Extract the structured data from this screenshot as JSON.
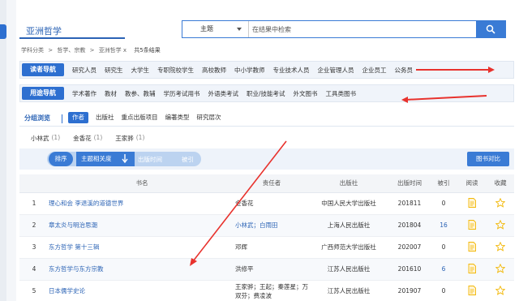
{
  "header": {
    "title": "亚洲哲学",
    "search": {
      "field": "主题",
      "placeholder": "在结果中检索"
    }
  },
  "breadcrumb": {
    "items": [
      "学科分类",
      ">",
      "哲学、宗教",
      ">",
      "亚洲哲学 x"
    ],
    "count": "共5条结果"
  },
  "reader_nav": {
    "label": "读者导航",
    "items": [
      "研究人员",
      "研究生",
      "大学生",
      "专职院校学生",
      "高校教师",
      "中小学教师",
      "专业技术人员",
      "企业管理人员",
      "企业员工",
      "公务员"
    ]
  },
  "purpose_nav": {
    "label": "用途导航",
    "items": [
      "学术著作",
      "教材",
      "教参、教辅",
      "学历考试用书",
      "外语类考试",
      "职业/技能考试",
      "外文图书",
      "工具类图书"
    ]
  },
  "group_browse": {
    "label": "分组浏览",
    "tabs": [
      "作者",
      "出版社",
      "重点出版项目",
      "编著类型",
      "研究层次"
    ]
  },
  "authors": [
    {
      "name": "小林武",
      "count": "(1)"
    },
    {
      "name": "金香花",
      "count": "(1)"
    },
    {
      "name": "王家骅",
      "count": "(1)"
    }
  ],
  "sort": {
    "label": "排序",
    "relevance": "主题相关度",
    "time": "出版时间",
    "cite": "被引",
    "compare": "图书对比"
  },
  "table": {
    "headers": [
      "书名",
      "责任者",
      "出版社",
      "出版时间",
      "被引",
      "阅读",
      "收藏"
    ],
    "rows": [
      {
        "no": "1",
        "title": "理心和会 李退溪的道德世界",
        "author": "金香花",
        "publisher": "中国人民大学出版社",
        "date": "201811",
        "cite": "0"
      },
      {
        "no": "2",
        "title": "章太炎与明治思潮",
        "author": "小林武；白雨田",
        "publisher": "上海人民出版社",
        "date": "201804",
        "cite": "16"
      },
      {
        "no": "3",
        "title": "东方哲学 第十三辑",
        "author": "邓辉",
        "publisher": "广西师范大学出版社",
        "date": "202007",
        "cite": "0"
      },
      {
        "no": "4",
        "title": "东方哲学与东方宗教",
        "author": "洪修平",
        "publisher": "江苏人民出版社",
        "date": "201610",
        "cite": "6"
      },
      {
        "no": "5",
        "title": "日本儒学史论",
        "author": "王家骅；王起；秦莲星；万双芬；费凌波",
        "publisher": "江苏人民出版社",
        "date": "201907",
        "cite": "0"
      }
    ]
  },
  "colors": {
    "accent": "#2d6fd0",
    "arrow": "#e8322d",
    "link": "#2b63b5",
    "star": "#f2b705",
    "doc": "#f2b705"
  },
  "icons": {
    "search": "search-icon",
    "sort": "arrow-down-icon",
    "read": "document-icon",
    "fav": "star-icon"
  }
}
